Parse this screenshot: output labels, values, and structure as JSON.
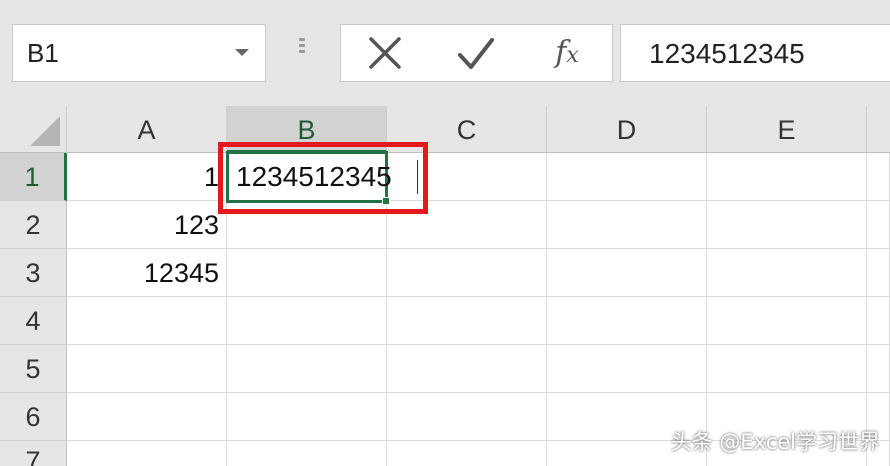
{
  "name_box": {
    "value": "B1"
  },
  "formula_bar": {
    "cancel_icon": "x-icon",
    "enter_icon": "check-icon",
    "fx_label": "f",
    "fx_sub": "x",
    "value": "1234512345"
  },
  "columns": [
    "A",
    "B",
    "C",
    "D",
    "E"
  ],
  "rows": [
    "1",
    "2",
    "3",
    "4",
    "5",
    "6",
    "7"
  ],
  "cells": {
    "A1": "1",
    "A2": "123",
    "A3": "12345",
    "B1": "1234512345"
  },
  "selection": {
    "column": "B",
    "row": "1"
  },
  "colors": {
    "accent": "#217346",
    "highlight": "#e2191f"
  },
  "watermark": "头条 @Excel学习世界"
}
